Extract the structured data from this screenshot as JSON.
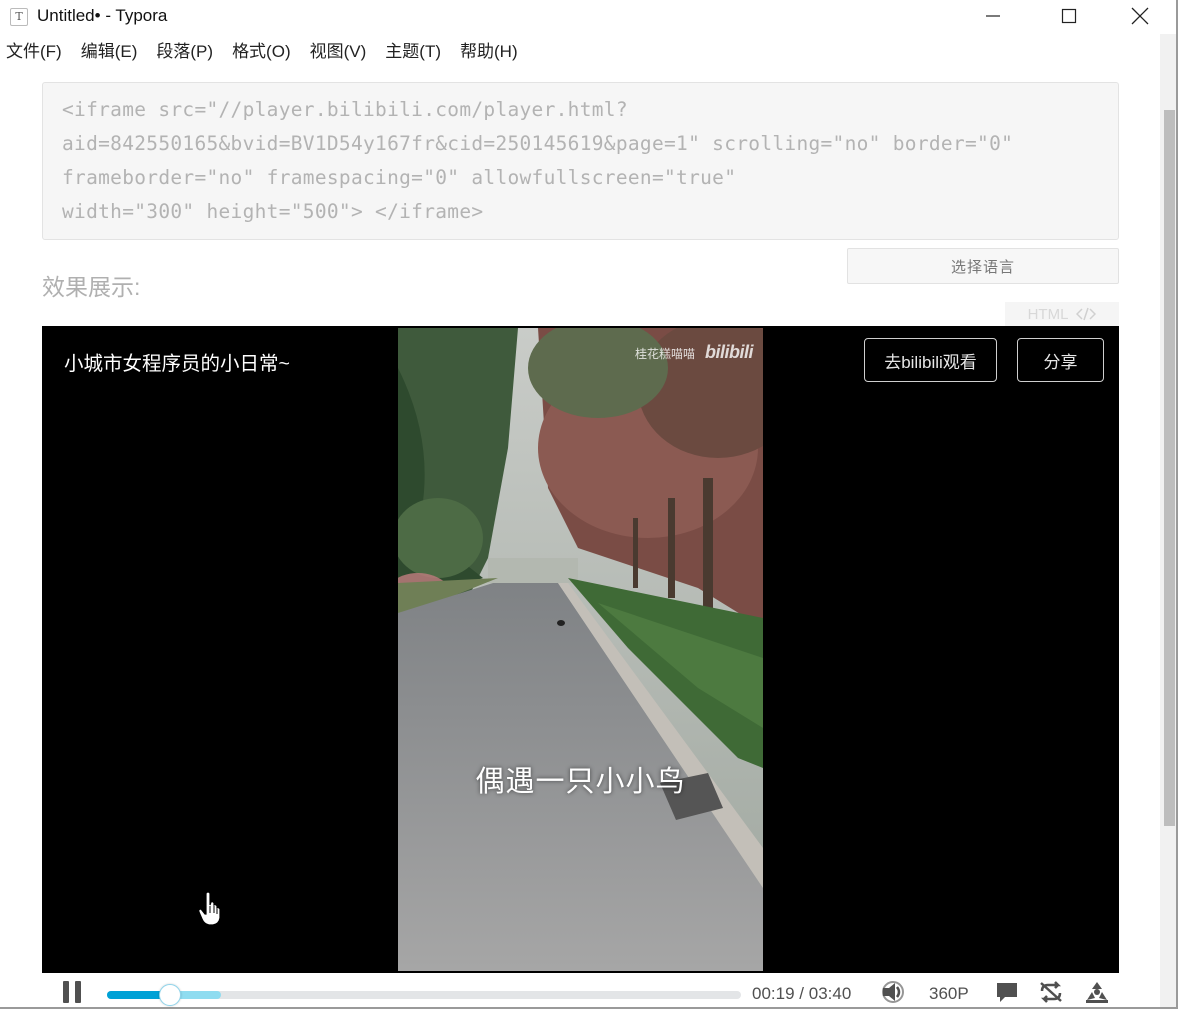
{
  "window": {
    "app_icon": "T",
    "title": "Untitled• - Typora",
    "controls": [
      "minimize-icon",
      "maximize-icon",
      "close-icon"
    ]
  },
  "menu": {
    "items": [
      "文件(F)",
      "编辑(E)",
      "段落(P)",
      "格式(O)",
      "视图(V)",
      "主题(T)",
      "帮助(H)"
    ]
  },
  "code_block": {
    "lines": [
      "<iframe src=\"//player.bilibili.com/player.html?",
      "aid=842550165&bvid=BV1D54y167fr&cid=250145619&page=1\" scrolling=\"no\" border=\"0\"",
      "frameborder=\"no\" framespacing=\"0\" allowfullscreen=\"true\"",
      "width=\"300\" height=\"500\"> </iframe>"
    ],
    "language_select": "选择语言"
  },
  "section_label": "效果展示:",
  "html_tag": {
    "label": "HTML",
    "icon": "code-icon"
  },
  "player": {
    "video_title": "小城市女程序员的小日常~",
    "watch_on_bilibili": "去bilibili观看",
    "share": "分享",
    "subtitle": "偶遇一只小小鸟",
    "watermark_user": "桂花糕喵喵",
    "watermark_brand": "bilibili",
    "time_current": "00:19",
    "time_separator": "/",
    "time_total": "03:40",
    "played_fraction": 0.1,
    "buffered_fraction": 0.18,
    "quality": "360P",
    "state": "playing",
    "control_icons": [
      "pause-icon",
      "volume-icon",
      "danmaku-icon",
      "loop-icon",
      "fullscreen-icon"
    ],
    "colors": {
      "accent": "#00a1d6",
      "buffer": "#8fdcf0"
    }
  }
}
